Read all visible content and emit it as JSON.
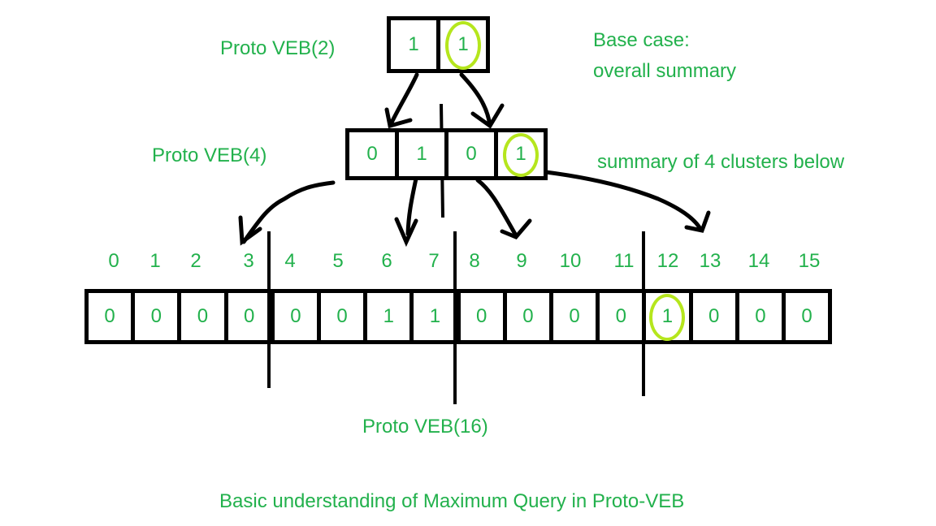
{
  "labels": {
    "veb2": "Proto VEB(2)",
    "veb4": "Proto VEB(4)",
    "veb16": "Proto VEB(16)",
    "base_case_line1": "Base case:",
    "base_case_line2": "overall summary",
    "summary_note": "summary of 4 clusters below",
    "caption": "Basic understanding of Maximum Query in Proto-VEB"
  },
  "veb2": {
    "cells": [
      "1",
      "1"
    ],
    "highlighted_index": 1
  },
  "veb4": {
    "cells": [
      "0",
      "1",
      "0",
      "1"
    ],
    "highlighted_index": 3
  },
  "veb16": {
    "indices": [
      "0",
      "1",
      "2",
      "3",
      "4",
      "5",
      "6",
      "7",
      "8",
      "9",
      "10",
      "11",
      "12",
      "13",
      "14",
      "15"
    ],
    "cells": [
      "0",
      "0",
      "0",
      "0",
      "0",
      "0",
      "1",
      "1",
      "0",
      "0",
      "0",
      "0",
      "1",
      "0",
      "0",
      "0"
    ],
    "highlighted_index": 12,
    "cluster_size": 4
  },
  "colors": {
    "text": "#22b14c",
    "highlight": "#b5e61d",
    "stroke": "#000000"
  }
}
